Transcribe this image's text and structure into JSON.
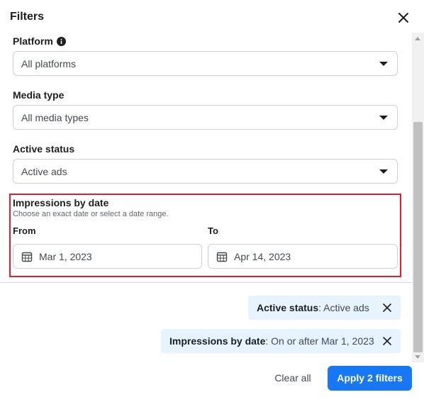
{
  "dialog": {
    "title": "Filters"
  },
  "platform": {
    "label": "Platform",
    "value": "All platforms"
  },
  "media_type": {
    "label": "Media type",
    "value": "All media types"
  },
  "active_status": {
    "label": "Active status",
    "value": "Active ads"
  },
  "impressions": {
    "label": "Impressions by date",
    "helper": "Choose an exact date or select a date range.",
    "from_label": "From",
    "to_label": "To",
    "from_value": "Mar 1, 2023",
    "to_value": "Apr 14, 2023"
  },
  "chips": [
    {
      "key": "Active status",
      "value": ": Active ads"
    },
    {
      "key": "Impressions by date",
      "value": ": On or after Mar 1, 2023"
    }
  ],
  "footer": {
    "clear_label": "Clear all",
    "apply_label": "Apply 2 filters"
  },
  "colors": {
    "accent": "#1877f2",
    "chip_bg": "#e7f3ff",
    "highlight": "#e0202e"
  },
  "icons": [
    "close-icon",
    "info-icon",
    "caret-down-icon",
    "calendar-icon"
  ]
}
